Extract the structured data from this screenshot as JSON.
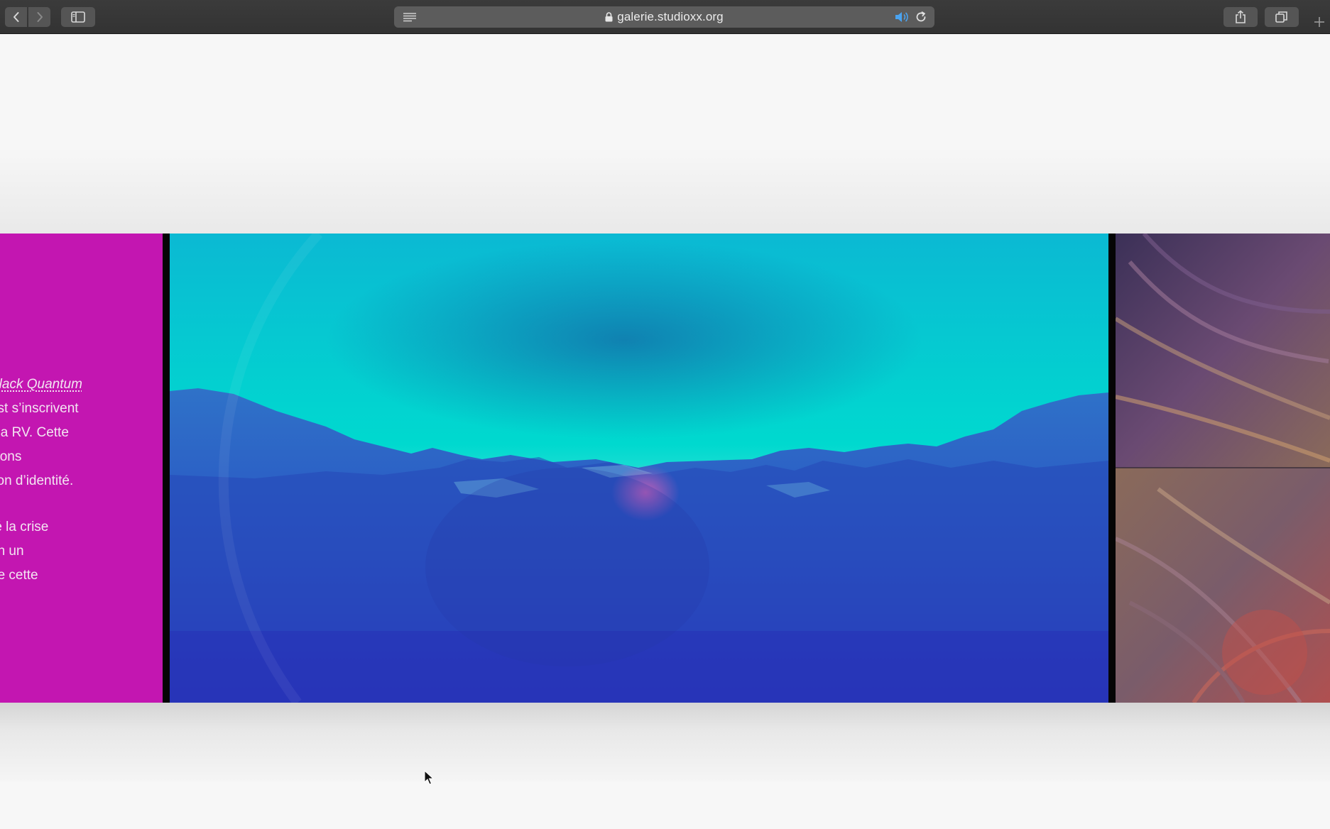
{
  "browser": {
    "url": "galerie.studioxx.org",
    "icons": {
      "back": "chevron-left-icon",
      "forward": "chevron-right-icon",
      "sidebar": "sidebar-icon",
      "reader": "reader-lines-icon",
      "lock": "lock-icon",
      "audio": "speaker-icon",
      "reload": "reload-icon",
      "share": "share-icon",
      "tabs": "tabs-overview-icon",
      "new_tab": "plus-icon"
    },
    "audio_color": "#4aa3f0"
  },
  "gallery": {
    "text_panel": {
      "background": "#c316b1",
      "title_link": "Black Quantum",
      "lines": [
        "rist s’inscrivent",
        "t la RV. Cette",
        "sions",
        "tion d’identité.",
        "",
        "ré la crise",
        "en un",
        "ne cette"
      ]
    },
    "main_image": {
      "alt": "",
      "sky_colors": [
        "#00d7cf",
        "#0fbfd6"
      ],
      "ground_colors": [
        "#2a5fc0",
        "#2a2fc0"
      ]
    },
    "side_image": {
      "alt": ""
    }
  }
}
